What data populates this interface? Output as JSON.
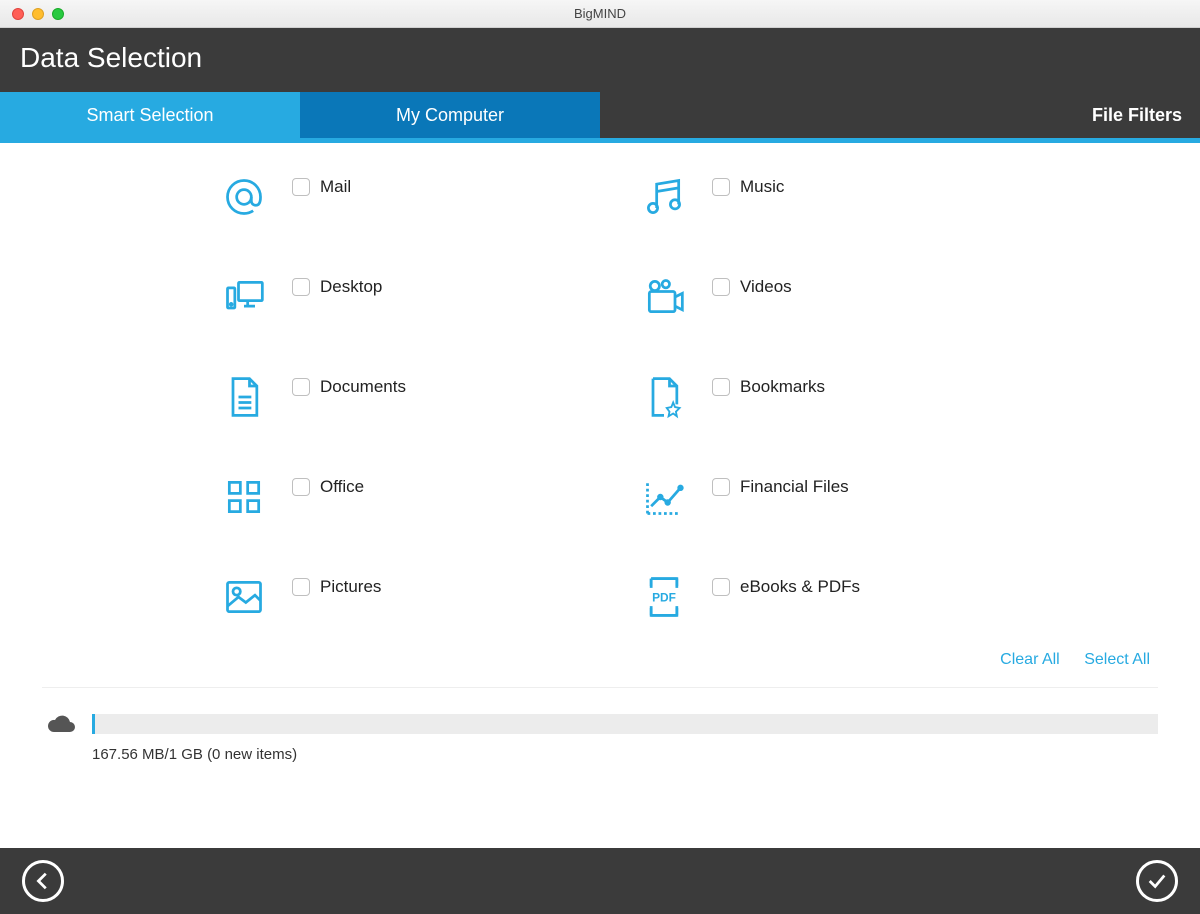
{
  "window": {
    "title": "BigMIND"
  },
  "header": {
    "page_title": "Data Selection"
  },
  "tabs": {
    "smart": "Smart Selection",
    "my_computer": "My Computer",
    "file_filters": "File Filters"
  },
  "categories": {
    "left": [
      {
        "icon": "at",
        "label": "Mail"
      },
      {
        "icon": "desktop",
        "label": "Desktop"
      },
      {
        "icon": "document",
        "label": "Documents"
      },
      {
        "icon": "office",
        "label": "Office"
      },
      {
        "icon": "pictures",
        "label": "Pictures"
      }
    ],
    "right": [
      {
        "icon": "music",
        "label": "Music"
      },
      {
        "icon": "videos",
        "label": "Videos"
      },
      {
        "icon": "bookmarks",
        "label": "Bookmarks"
      },
      {
        "icon": "financial",
        "label": "Financial Files"
      },
      {
        "icon": "pdf",
        "label": "eBooks & PDFs"
      }
    ]
  },
  "actions": {
    "clear_all": "Clear All",
    "select_all": "Select All"
  },
  "storage": {
    "text": "167.56 MB/1 GB (0 new items)"
  }
}
